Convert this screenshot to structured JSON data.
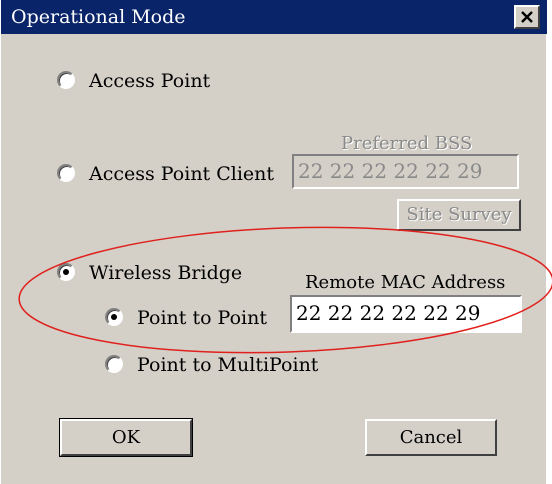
{
  "window": {
    "title": "Operational Mode",
    "close_icon": "close-icon"
  },
  "modes": {
    "access_point": {
      "label": "Access Point",
      "selected": false
    },
    "access_point_client": {
      "label": "Access Point Client",
      "selected": false
    },
    "wireless_bridge": {
      "label": "Wireless Bridge",
      "selected": true
    }
  },
  "client_settings": {
    "preferred_bss_label": "Preferred BSS",
    "preferred_bss_value": "22 22 22 22 22 29",
    "site_survey_label": "Site Survey"
  },
  "bridge_settings": {
    "point_to_point": {
      "label": "Point to Point",
      "selected": true
    },
    "point_to_multipoint": {
      "label": "Point to MultiPoint",
      "selected": false
    },
    "remote_mac_label": "Remote MAC Address",
    "remote_mac_value": "22 22 22 22 22 29"
  },
  "buttons": {
    "ok": "OK",
    "cancel": "Cancel"
  },
  "colors": {
    "title_bar": "#0a246a",
    "dialog_face": "#d4d0c8",
    "annotation_ellipse": "#e0201c"
  }
}
